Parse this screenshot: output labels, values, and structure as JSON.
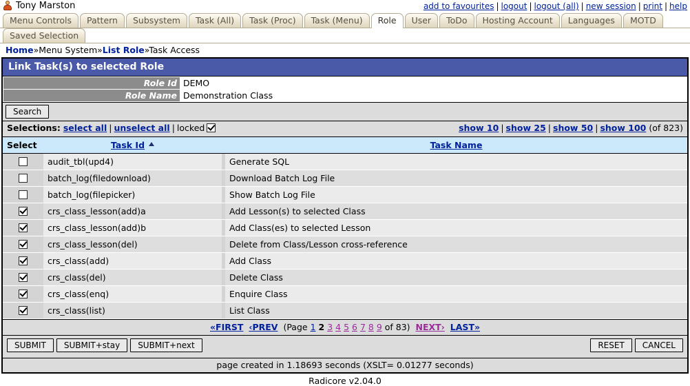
{
  "topbar": {
    "user_icon": "user-avatar-icon",
    "user_name": "Tony Marston",
    "links": [
      {
        "label": "add to favourites"
      },
      {
        "label": "logout"
      },
      {
        "label": "logout (all)"
      },
      {
        "label": "new session"
      },
      {
        "label": "print"
      },
      {
        "label": "help"
      }
    ],
    "separator": "|"
  },
  "tabs_row1": [
    {
      "label": "Menu Controls",
      "active": false
    },
    {
      "label": "Pattern",
      "active": false
    },
    {
      "label": "Subsystem",
      "active": false
    },
    {
      "label": "Task (All)",
      "active": false
    },
    {
      "label": "Task (Proc)",
      "active": false
    },
    {
      "label": "Task (Menu)",
      "active": false
    },
    {
      "label": "Role",
      "active": true
    },
    {
      "label": "User",
      "active": false
    },
    {
      "label": "ToDo",
      "active": false
    },
    {
      "label": "Hosting Account",
      "active": false
    },
    {
      "label": "Languages",
      "active": false
    },
    {
      "label": "MOTD",
      "active": false
    }
  ],
  "tabs_row2": [
    {
      "label": "Saved Selection",
      "active": false
    }
  ],
  "breadcrumb": {
    "separator": "»",
    "items": [
      {
        "label": "Home",
        "link": true
      },
      {
        "label": "Menu System",
        "link": false
      },
      {
        "label": "List Role",
        "link": true
      },
      {
        "label": "Task Access",
        "link": false
      }
    ]
  },
  "panel": {
    "title": "Link Task(s) to selected Role",
    "fields": [
      {
        "label": "Role Id",
        "value": "DEMO"
      },
      {
        "label": "Role Name",
        "value": "Demonstration Class"
      }
    ]
  },
  "toolbar": {
    "search_label": "Search"
  },
  "selections": {
    "prefix": "Selections:",
    "select_all": "select all",
    "unselect_all": "unselect all",
    "locked_label": "locked",
    "locked_checked": true,
    "separator": "|",
    "show_links": [
      {
        "label": "show 10"
      },
      {
        "label": "show 25"
      },
      {
        "label": "show 50"
      },
      {
        "label": "show 100"
      }
    ],
    "total_text": "(of 823)"
  },
  "grid": {
    "headers": {
      "select": "Select",
      "task_id": "Task Id",
      "task_name": "Task Name",
      "sort_indicator": "sort-ascending-icon"
    },
    "rows": [
      {
        "checked": false,
        "task_id": "audit_tbl(upd4)",
        "task_name": "Generate SQL"
      },
      {
        "checked": false,
        "task_id": "batch_log(filedownload)",
        "task_name": "Download Batch Log File"
      },
      {
        "checked": false,
        "task_id": "batch_log(filepicker)",
        "task_name": "Show Batch Log File"
      },
      {
        "checked": true,
        "task_id": "crs_class_lesson(add)a",
        "task_name": "Add Lesson(s) to selected Class"
      },
      {
        "checked": true,
        "task_id": "crs_class_lesson(add)b",
        "task_name": "Add Class(es) to selected Lesson"
      },
      {
        "checked": true,
        "task_id": "crs_class_lesson(del)",
        "task_name": "Delete from Class/Lesson cross-reference"
      },
      {
        "checked": true,
        "task_id": "crs_class(add)",
        "task_name": "Add Class"
      },
      {
        "checked": true,
        "task_id": "crs_class(del)",
        "task_name": "Delete Class"
      },
      {
        "checked": true,
        "task_id": "crs_class(enq)",
        "task_name": "Enquire Class"
      },
      {
        "checked": true,
        "task_id": "crs_class(list)",
        "task_name": "List Class"
      }
    ]
  },
  "pager": {
    "first": "«FIRST",
    "prev": "‹PREV",
    "page_prefix": "(Page",
    "pages": [
      {
        "label": "1",
        "state": "unvisited"
      },
      {
        "label": "2",
        "state": "current"
      },
      {
        "label": "3",
        "state": "visited"
      },
      {
        "label": "4",
        "state": "visited"
      },
      {
        "label": "5",
        "state": "visited"
      },
      {
        "label": "6",
        "state": "visited"
      },
      {
        "label": "7",
        "state": "visited"
      },
      {
        "label": "8",
        "state": "visited"
      },
      {
        "label": "9",
        "state": "visited"
      }
    ],
    "page_suffix": "of 83)",
    "next": "NEXT›",
    "last": "LAST»"
  },
  "footer": {
    "submit": "SUBMIT",
    "submit_stay": "SUBMIT+stay",
    "submit_next": "SUBMIT+next",
    "reset": "RESET",
    "cancel": "CANCEL",
    "page_created": "page created in 1.18693 seconds (XSLT= 0.01277 seconds)",
    "version": "Radicore v2.04.0"
  },
  "colors": {
    "title_bar": "#4a5aa8",
    "link": "#00219c",
    "visited_link": "#9a2b9a",
    "header_row": "#cce9fb",
    "strip": "#dcdcdc"
  }
}
